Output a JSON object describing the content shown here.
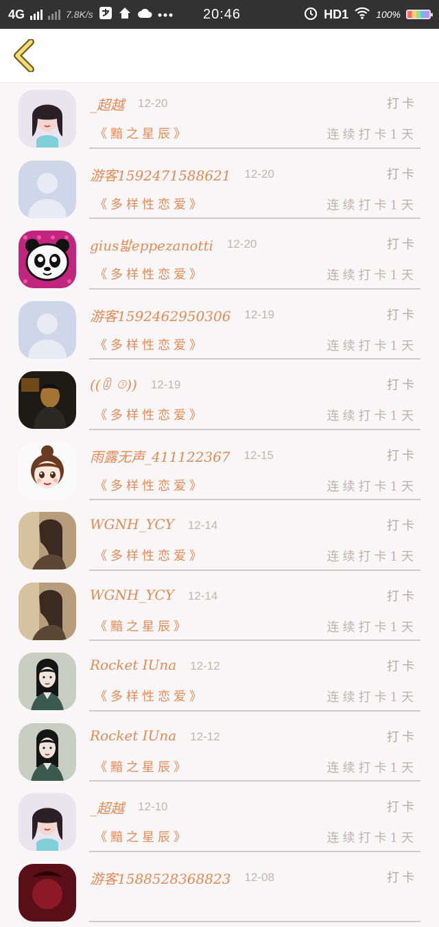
{
  "status_bar": {
    "network": "4G",
    "speed": "7.8K/s",
    "time": "20:46",
    "hd": "HD1",
    "battery": "100%"
  },
  "header": {
    "back_icon": "chevron-left-icon"
  },
  "entries": [
    {
      "name": "_超越",
      "date": "12-20",
      "punch": "打卡",
      "book": "《黯之星辰》",
      "streak": "连续打卡1天",
      "avatar": "girl-photo"
    },
    {
      "name": "游客1592471588621",
      "date": "12-20",
      "punch": "打卡",
      "book": "《多样性恋爱》",
      "streak": "连续打卡1天",
      "avatar": "default-user"
    },
    {
      "name": "gius밟eppezanotti",
      "date": "12-20",
      "punch": "打卡",
      "book": "《多样性恋爱》",
      "streak": "连续打卡1天",
      "avatar": "panda"
    },
    {
      "name": "游客1592462950306",
      "date": "12-19",
      "punch": "打卡",
      "book": "《多样性恋爱》",
      "streak": "连续打卡1天",
      "avatar": "default-user"
    },
    {
      "name": "((ꀧ ③))",
      "date": "12-19",
      "punch": "打卡",
      "book": "《多样性恋爱》",
      "streak": "连续打卡1天",
      "avatar": "dark-photo"
    },
    {
      "name": "雨露无声_411122367",
      "date": "12-15",
      "punch": "打卡",
      "book": "《多样性恋爱》",
      "streak": "连续打卡1天",
      "avatar": "cartoon-girl"
    },
    {
      "name": "WGNH_YCY",
      "date": "12-14",
      "punch": "打卡",
      "book": "《多样性恋爱》",
      "streak": "连续打卡1天",
      "avatar": "sepia-photo"
    },
    {
      "name": "WGNH_YCY",
      "date": "12-14",
      "punch": "打卡",
      "book": "《黯之星辰》",
      "streak": "连续打卡1天",
      "avatar": "sepia-photo"
    },
    {
      "name": "Rocket IUna",
      "date": "12-12",
      "punch": "打卡",
      "book": "《多样性恋爱》",
      "streak": "连续打卡1天",
      "avatar": "ink-girl"
    },
    {
      "name": "Rocket IUna",
      "date": "12-12",
      "punch": "打卡",
      "book": "《黯之星辰》",
      "streak": "连续打卡1天",
      "avatar": "ink-girl"
    },
    {
      "name": "_超越",
      "date": "12-10",
      "punch": "打卡",
      "book": "《黯之星辰》",
      "streak": "连续打卡1天",
      "avatar": "girl-photo"
    },
    {
      "name": "游客1588528368823",
      "date": "12-08",
      "punch": "打卡",
      "book": "",
      "streak": "",
      "avatar": "red-photo"
    }
  ],
  "colors": {
    "accent": "#e58a54",
    "back_icon_fill": "#f4dd6a",
    "back_icon_stroke": "#6b5b2a"
  }
}
